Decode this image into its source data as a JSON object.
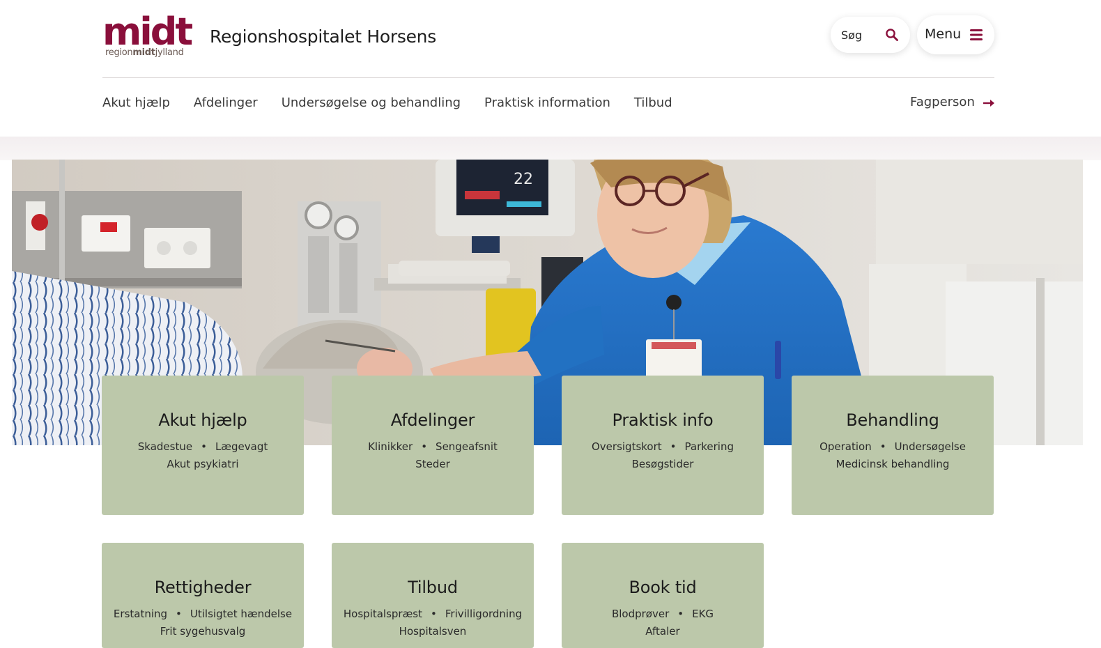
{
  "header": {
    "logo_word": "midt",
    "logo_sub_a": "region",
    "logo_sub_b": "midt",
    "logo_sub_c": "jylland",
    "site_name": "Regionshospitalet Horsens",
    "search_label": "Søg",
    "menu_label": "Menu"
  },
  "nav": {
    "items": [
      "Akut hjælp",
      "Afdelinger",
      "Undersøgelse og behandling",
      "Praktisk information",
      "Tilbud"
    ],
    "fagperson": "Fagperson"
  },
  "colors": {
    "brand": "#8a0f3b",
    "card": "#bcc8aa",
    "nurse_scrubs": "#1f6fc0"
  },
  "cards": [
    {
      "title": "Akut hjælp",
      "links": [
        "Skadestue",
        "Lægevagt",
        "Akut psykiatri"
      ]
    },
    {
      "title": "Afdelinger",
      "links": [
        "Klinikker",
        "Sengeafsnit",
        "Steder"
      ]
    },
    {
      "title": "Praktisk info",
      "links": [
        "Oversigtskort",
        "Parkering",
        "Besøgstider"
      ]
    },
    {
      "title": "Behandling",
      "links": [
        "Operation",
        "Undersøgelse",
        "Medicinsk behandling"
      ]
    },
    {
      "title": "Rettigheder",
      "links": [
        "Erstatning",
        "Utilsigtet hændelse",
        "Frit sygehusvalg"
      ]
    },
    {
      "title": "Tilbud",
      "links": [
        "Hospitalspræst",
        "Frivilligordning",
        "Hospitalsven"
      ]
    },
    {
      "title": "Book tid",
      "links": [
        "Blodprøver",
        "EKG",
        "Aftaler"
      ]
    }
  ],
  "hero": {
    "monitor_value": "22",
    "icons": [
      "search-icon",
      "menu-icon",
      "arrow-right-icon"
    ]
  }
}
